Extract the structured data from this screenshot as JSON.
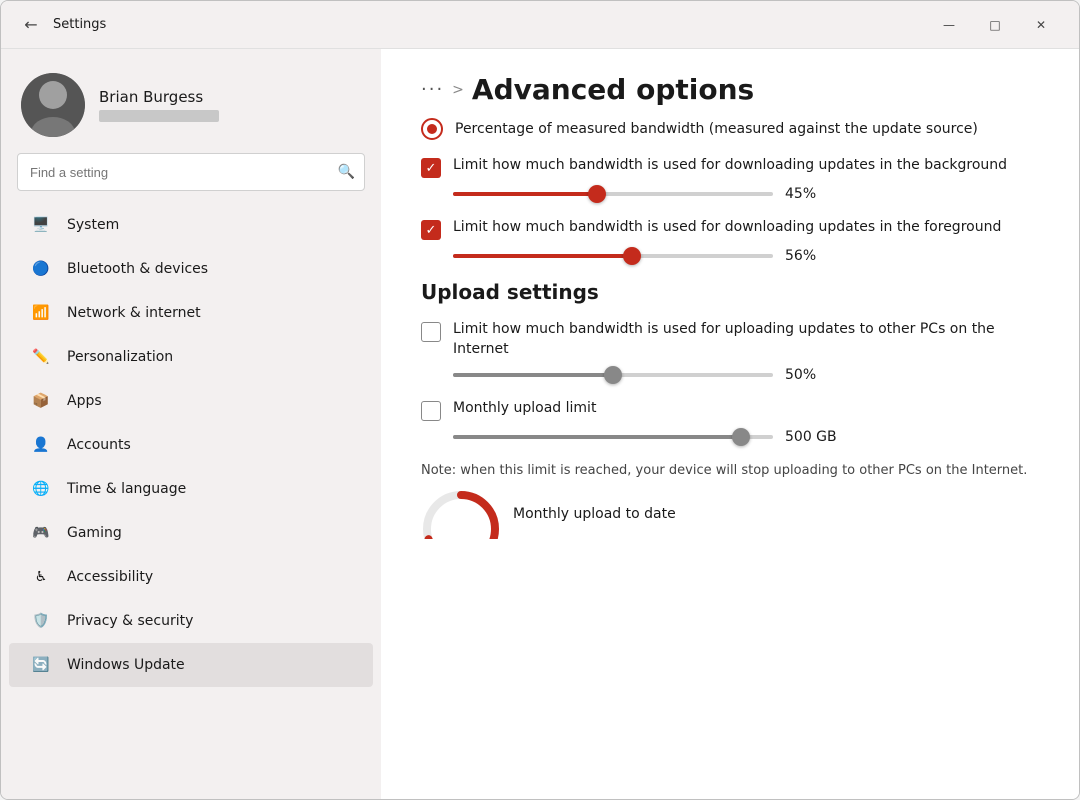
{
  "titlebar": {
    "back_label": "←",
    "title": "Settings",
    "min_label": "—",
    "max_label": "□",
    "close_label": "✕"
  },
  "user": {
    "name": "Brian Burgess"
  },
  "search": {
    "placeholder": "Find a setting"
  },
  "nav": [
    {
      "id": "system",
      "label": "System",
      "icon": "🖥️"
    },
    {
      "id": "bluetooth",
      "label": "Bluetooth & devices",
      "icon": "🔵"
    },
    {
      "id": "network",
      "label": "Network & internet",
      "icon": "📶"
    },
    {
      "id": "personalization",
      "label": "Personalization",
      "icon": "✏️"
    },
    {
      "id": "apps",
      "label": "Apps",
      "icon": "📦"
    },
    {
      "id": "accounts",
      "label": "Accounts",
      "icon": "👤"
    },
    {
      "id": "time",
      "label": "Time & language",
      "icon": "🌐"
    },
    {
      "id": "gaming",
      "label": "Gaming",
      "icon": "🎮"
    },
    {
      "id": "accessibility",
      "label": "Accessibility",
      "icon": "♿"
    },
    {
      "id": "privacy",
      "label": "Privacy & security",
      "icon": "🛡️"
    },
    {
      "id": "update",
      "label": "Windows Update",
      "icon": "🔄"
    }
  ],
  "breadcrumb": {
    "dots": "···",
    "sep": ">",
    "title": "Advanced options"
  },
  "download": {
    "radio_label": "Percentage of measured bandwidth (measured against the update source)",
    "bg_checkbox_label": "Limit how much bandwidth is used for downloading updates in the background",
    "bg_value": "45%",
    "bg_percent": 45,
    "fg_checkbox_label": "Limit how much bandwidth is used for downloading updates in the foreground",
    "fg_value": "56%",
    "fg_percent": 56
  },
  "upload": {
    "title": "Upload settings",
    "internet_checkbox_label": "Limit how much bandwidth is used for uploading updates to other PCs on the Internet",
    "internet_value": "50%",
    "internet_percent": 50,
    "monthly_label": "Monthly upload limit",
    "monthly_value": "500 GB",
    "monthly_percent": 90,
    "note": "Note: when this limit is reached, your device will stop uploading to other PCs on the Internet.",
    "monthly_date_label": "Monthly upload to date"
  }
}
